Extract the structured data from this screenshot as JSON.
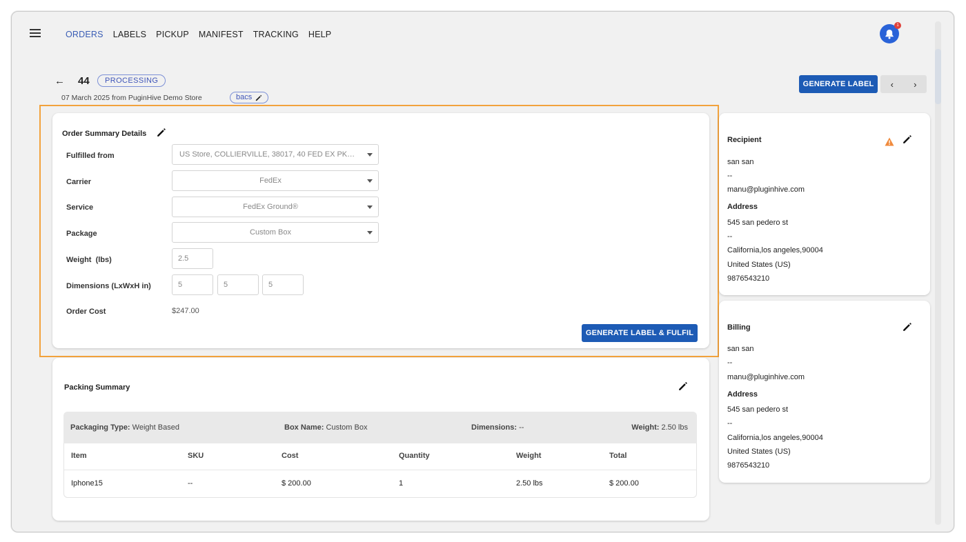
{
  "nav": {
    "items": [
      "ORDERS",
      "LABELS",
      "PICKUP",
      "MANIFEST",
      "TRACKING",
      "HELP"
    ],
    "active": "ORDERS"
  },
  "notifications": {
    "count": "1"
  },
  "order": {
    "number": "44",
    "status": "PROCESSING",
    "subtitle": "07 March 2025 from PuginHive Demo Store",
    "payment_method": "bacs"
  },
  "header_actions": {
    "generate_label": "GENERATE LABEL",
    "prev": "‹",
    "next": "›"
  },
  "order_summary": {
    "title": "Order Summary Details",
    "fields": {
      "fulfilled_from": {
        "label": "Fulfilled from",
        "value": "US Store, COLLIERVILLE, 38017, 40 FED EX PKWY..."
      },
      "carrier": {
        "label": "Carrier",
        "value": "FedEx"
      },
      "service": {
        "label": "Service",
        "value": "FedEx Ground®"
      },
      "package": {
        "label": "Package",
        "value": "Custom Box"
      },
      "weight": {
        "label": "Weight  (lbs)",
        "value": "2.5"
      },
      "dimensions": {
        "label": "Dimensions (LxWxH in)",
        "length": "5",
        "width": "5",
        "height": "5"
      },
      "order_cost": {
        "label": "Order Cost",
        "value": "$247.00"
      }
    },
    "fulfil_button": "GENERATE LABEL & FULFIL"
  },
  "packing_summary": {
    "title": "Packing Summary",
    "packaging_type_label": "Packaging Type:",
    "packaging_type": "Weight Based",
    "box_name_label": "Box Name:",
    "box_name": "Custom Box",
    "dimensions_label": "Dimensions:",
    "dimensions": "--",
    "weight_label": "Weight:",
    "weight": "2.50 lbs",
    "columns": [
      "Item",
      "SKU",
      "Cost",
      "Quantity",
      "Weight",
      "Total"
    ],
    "rows": [
      {
        "item": "Iphone15",
        "sku": "--",
        "cost": "$ 200.00",
        "quantity": "1",
        "weight": "2.50 lbs",
        "total": "$ 200.00"
      }
    ]
  },
  "recipient": {
    "title": "Recipient",
    "name": "san san",
    "company": "--",
    "email": "manu@pluginhive.com",
    "address_label": "Address",
    "address1": "545 san pedero st",
    "address2": "--",
    "city_line": "California,los angeles,90004",
    "country": "United States (US)",
    "phone": "9876543210"
  },
  "billing": {
    "title": "Billing",
    "name": "san san",
    "company": "--",
    "email": "manu@pluginhive.com",
    "address_label": "Address",
    "address1": "545 san pedero st",
    "address2": "--",
    "city_line": "California,los angeles,90004",
    "country": "United States (US)",
    "phone": "9876543210"
  },
  "colors": {
    "primary_button": "#1d5bb5",
    "active_nav": "#3a5db5",
    "highlight_border": "#f2a23c",
    "warning": "#f08a3c",
    "bell": "#2a63d8"
  }
}
